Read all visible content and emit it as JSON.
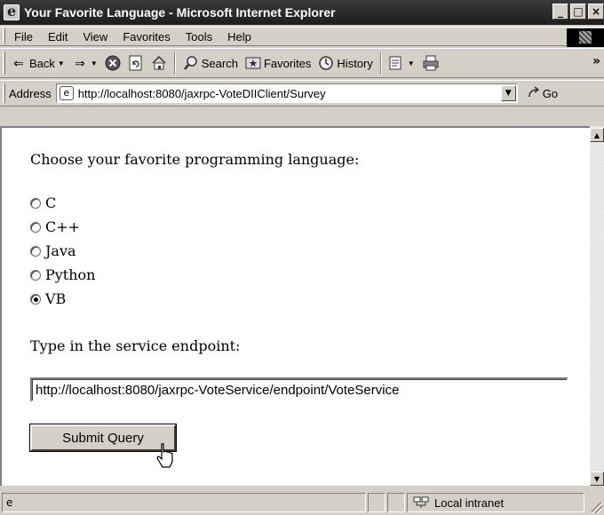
{
  "window": {
    "title": "Your Favorite Language - Microsoft Internet Explorer",
    "buttons": [
      "_",
      "□",
      "×"
    ]
  },
  "menubar": {
    "items": [
      "File",
      "Edit",
      "View",
      "Favorites",
      "Tools",
      "Help"
    ]
  },
  "toolbar": {
    "back_label": "Back",
    "search_label": "Search",
    "favorites_label": "Favorites",
    "history_label": "History",
    "more": "»"
  },
  "address": {
    "label": "Address",
    "url": "http://localhost:8080/jaxrpc-VoteDIIClient/Survey",
    "go_label": "Go"
  },
  "page": {
    "prompt": "Choose your favorite programming language:",
    "options": [
      {
        "label": "C",
        "checked": false
      },
      {
        "label": "C++",
        "checked": false
      },
      {
        "label": "Java",
        "checked": false
      },
      {
        "label": "Python",
        "checked": false
      },
      {
        "label": "VB",
        "checked": true
      }
    ],
    "endpoint_label": "Type in the service endpoint:",
    "endpoint_value": "http://localhost:8080/jaxrpc-VoteService/endpoint/VoteService",
    "submit_label": "Submit Query"
  },
  "status": {
    "zone": "Local intranet"
  }
}
